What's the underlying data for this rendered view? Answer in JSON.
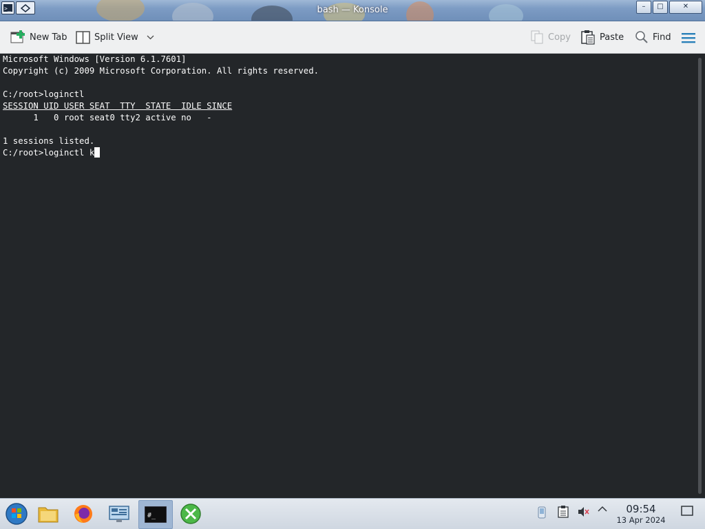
{
  "window": {
    "title": "bash — Konsole",
    "buttons": {
      "minimize": "–",
      "maximize": "□",
      "close": "✕"
    }
  },
  "toolbar": {
    "new_tab": "New Tab",
    "split_view": "Split View",
    "copy": "Copy",
    "paste": "Paste",
    "find": "Find"
  },
  "terminal": {
    "lines": [
      "Microsoft Windows [Version 6.1.7601]",
      "Copyright (c) 2009 Microsoft Corporation. All rights reserved.",
      "",
      "C:/root>loginctl",
      "SESSION UID USER SEAT  TTY  STATE  IDLE SINCE",
      "      1   0 root seat0 tty2 active no   -",
      "",
      "1 sessions listed.",
      "C:/root>loginctl k"
    ]
  },
  "taskbar": {
    "clock_time": "09:54",
    "clock_date": "13 Apr 2024",
    "term_icon_text": "#_"
  },
  "colors": {
    "terminal_bg": "#232629",
    "terminal_fg": "#fcfcfc",
    "toolbar_bg": "#eff0f1",
    "accent": "#3daee9"
  }
}
